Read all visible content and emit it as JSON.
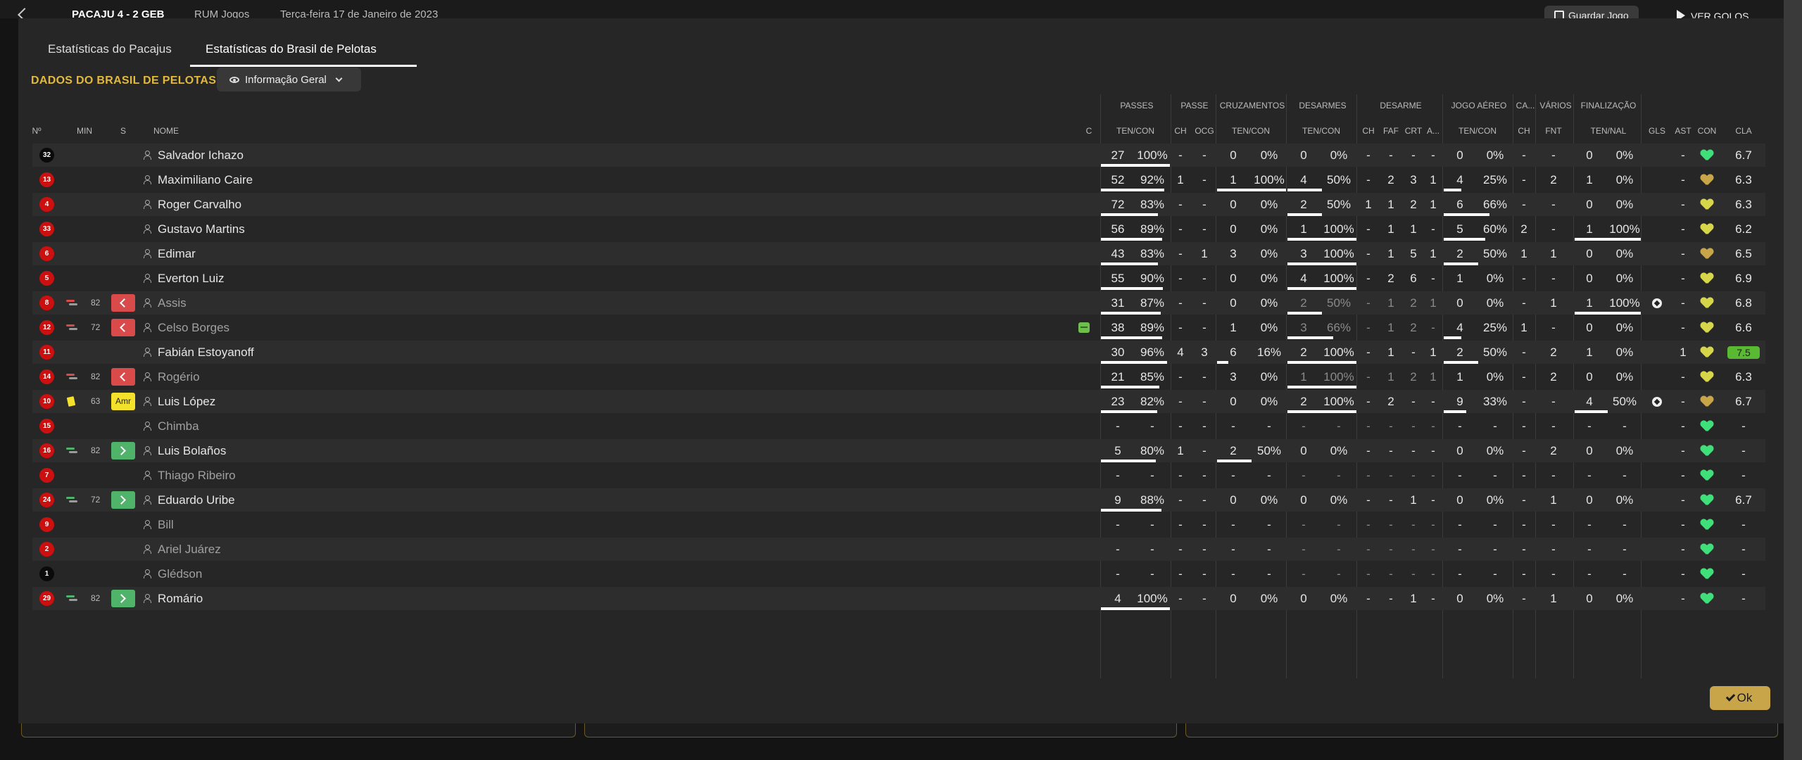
{
  "topbar": {
    "score_text": "PACAJU 4 - 2 GEB",
    "venue": "RUM Jogos",
    "date": "Terça-feira 17 de Janeiro de 2023",
    "save_label": "Guardar Jogo",
    "goals_label": "VER GOLOS"
  },
  "tabs": [
    {
      "label": "Estatísticas do Pacajus"
    },
    {
      "label": "Estatísticas do Brasil de Pelotas"
    }
  ],
  "section_title": "DADOS DO BRASIL DE PELOTAS",
  "view_dropdown": {
    "label": "Informação Geral"
  },
  "group_headers": {
    "passes": "PASSES",
    "passe": "PASSE",
    "cruzamentos": "CRUZAMENTOS",
    "desarmes": "DESARMES",
    "desarme": "DESARME",
    "jogo_aereo": "JOGO AÉREO",
    "ca": "CA...",
    "varios": "VÁRIOS",
    "finalizacao": "FINALIZAÇÃO"
  },
  "col_headers": {
    "num": "Nº",
    "min": "MIN",
    "s": "S",
    "nome": "NOME",
    "c": "C",
    "passes_tc": "TEN/CON",
    "passe_ch": "CH",
    "passe_ocg": "OCG",
    "cruz_tc": "TEN/CON",
    "des_tc": "TEN/CON",
    "d_ch": "CH",
    "d_faf": "FAF",
    "d_crt": "CRT",
    "d_a": "A...",
    "aer_tc": "TEN/CON",
    "ca_ch": "CH",
    "fnt": "FNT",
    "fin_tn": "TEN/NAL",
    "gls": "GLS",
    "ast": "AST",
    "con": "CON",
    "cla": "CLA"
  },
  "colors": {
    "accent": "#e2b93b",
    "ok_button": "#c9a54a",
    "kit_red": "#cc1010",
    "kit_black": "#0a0a0a"
  },
  "players": [
    {
      "num": "32",
      "kit": "black",
      "min": "",
      "sub": "",
      "name": "Salvador Ichazo",
      "active": true,
      "c": "",
      "pt": "27",
      "pp": "100%",
      "pb": 100,
      "pch": "-",
      "pocg": "-",
      "ct": "0",
      "cp": "0%",
      "cb": 0,
      "dt": "0",
      "dp": "0%",
      "db": 0,
      "dch": "-",
      "faf": "-",
      "crt": "-",
      "da": "-",
      "at": "0",
      "ap": "0%",
      "ab": 0,
      "cach": "-",
      "fnt": "-",
      "ft": "0",
      "fp": "0%",
      "fb": 0,
      "gls": "",
      "ast": "-",
      "con": "green",
      "cla": "6.7",
      "ball": false
    },
    {
      "num": "13",
      "kit": "red",
      "min": "",
      "sub": "",
      "name": "Maximiliano Caire",
      "active": true,
      "c": "",
      "pt": "52",
      "pp": "92%",
      "pb": 92,
      "pch": "1",
      "pocg": "-",
      "ct": "1",
      "cp": "100%",
      "cb": 100,
      "dt": "4",
      "dp": "50%",
      "db": 50,
      "dch": "-",
      "faf": "2",
      "crt": "3",
      "da": "1",
      "at": "4",
      "ap": "25%",
      "ab": 25,
      "cach": "-",
      "fnt": "2",
      "ft": "1",
      "fp": "0%",
      "fb": 0,
      "gls": "",
      "ast": "-",
      "con": "gold",
      "cla": "6.3",
      "ball": false
    },
    {
      "num": "4",
      "kit": "red",
      "min": "",
      "sub": "",
      "name": "Roger Carvalho",
      "active": true,
      "c": "",
      "pt": "72",
      "pp": "83%",
      "pb": 83,
      "pch": "-",
      "pocg": "-",
      "ct": "0",
      "cp": "0%",
      "cb": 0,
      "dt": "2",
      "dp": "50%",
      "db": 50,
      "dch": "1",
      "faf": "1",
      "crt": "2",
      "da": "1",
      "at": "6",
      "ap": "66%",
      "ab": 66,
      "cach": "-",
      "fnt": "-",
      "ft": "0",
      "fp": "0%",
      "fb": 0,
      "gls": "",
      "ast": "-",
      "con": "yellow",
      "cla": "6.3",
      "ball": false
    },
    {
      "num": "33",
      "kit": "red",
      "min": "",
      "sub": "",
      "name": "Gustavo Martins",
      "active": true,
      "c": "",
      "pt": "56",
      "pp": "89%",
      "pb": 89,
      "pch": "-",
      "pocg": "-",
      "ct": "0",
      "cp": "0%",
      "cb": 0,
      "dt": "1",
      "dp": "100%",
      "db": 100,
      "dch": "-",
      "faf": "1",
      "crt": "1",
      "da": "-",
      "at": "5",
      "ap": "60%",
      "ab": 60,
      "cach": "2",
      "fnt": "-",
      "ft": "1",
      "fp": "100%",
      "fb": 100,
      "gls": "",
      "ast": "-",
      "con": "yellow",
      "cla": "6.2",
      "ball": false
    },
    {
      "num": "6",
      "kit": "red",
      "min": "",
      "sub": "",
      "name": "Edimar",
      "active": true,
      "c": "",
      "pt": "43",
      "pp": "83%",
      "pb": 83,
      "pch": "-",
      "pocg": "1",
      "ct": "3",
      "cp": "0%",
      "cb": 0,
      "dt": "3",
      "dp": "100%",
      "db": 100,
      "dch": "-",
      "faf": "1",
      "crt": "5",
      "da": "1",
      "at": "2",
      "ap": "50%",
      "ab": 50,
      "cach": "1",
      "fnt": "1",
      "ft": "0",
      "fp": "0%",
      "fb": 0,
      "gls": "",
      "ast": "-",
      "con": "gold",
      "cla": "6.5",
      "ball": false
    },
    {
      "num": "5",
      "kit": "red",
      "min": "",
      "sub": "",
      "name": "Everton Luiz",
      "active": true,
      "c": "",
      "pt": "55",
      "pp": "90%",
      "pb": 90,
      "pch": "-",
      "pocg": "-",
      "ct": "0",
      "cp": "0%",
      "cb": 0,
      "dt": "4",
      "dp": "100%",
      "db": 100,
      "dch": "-",
      "faf": "2",
      "crt": "6",
      "da": "-",
      "at": "1",
      "ap": "0%",
      "ab": 0,
      "cach": "-",
      "fnt": "-",
      "ft": "0",
      "fp": "0%",
      "fb": 0,
      "gls": "",
      "ast": "-",
      "con": "yellow",
      "cla": "6.9",
      "ball": false
    },
    {
      "num": "8",
      "kit": "red",
      "min": "82",
      "sub": "out",
      "name": "Assis",
      "active": false,
      "c": "",
      "pt": "31",
      "pp": "87%",
      "pb": 87,
      "pch": "-",
      "pocg": "-",
      "ct": "0",
      "cp": "0%",
      "cb": 0,
      "dt": "2",
      "dp": "50%",
      "db": 50,
      "dch": "-",
      "faf": "1",
      "crt": "2",
      "da": "1",
      "at": "0",
      "ap": "0%",
      "ab": 0,
      "cach": "-",
      "fnt": "1",
      "ft": "1",
      "fp": "100%",
      "fb": 100,
      "gls": "ball",
      "ast": "-",
      "con": "yellow",
      "cla": "6.8",
      "ball": true
    },
    {
      "num": "12",
      "kit": "red",
      "min": "72",
      "sub": "out",
      "name": "Celso Borges",
      "active": false,
      "c": "injury",
      "pt": "38",
      "pp": "89%",
      "pb": 89,
      "pch": "-",
      "pocg": "-",
      "ct": "1",
      "cp": "0%",
      "cb": 0,
      "dt": "3",
      "dp": "66%",
      "db": 66,
      "dch": "-",
      "faf": "1",
      "crt": "2",
      "da": "-",
      "at": "4",
      "ap": "25%",
      "ab": 25,
      "cach": "1",
      "fnt": "-",
      "ft": "0",
      "fp": "0%",
      "fb": 0,
      "gls": "",
      "ast": "-",
      "con": "yellow",
      "cla": "6.6",
      "ball": false
    },
    {
      "num": "11",
      "kit": "red",
      "min": "",
      "sub": "",
      "name": "Fabián Estoyanoff",
      "active": true,
      "c": "",
      "pt": "30",
      "pp": "96%",
      "pb": 96,
      "pch": "4",
      "pocg": "3",
      "ct": "6",
      "cp": "16%",
      "cb": 16,
      "dt": "2",
      "dp": "100%",
      "db": 100,
      "dch": "-",
      "faf": "1",
      "crt": "-",
      "da": "1",
      "at": "2",
      "ap": "50%",
      "ab": 50,
      "cach": "-",
      "fnt": "2",
      "ft": "1",
      "fp": "0%",
      "fb": 0,
      "gls": "",
      "ast": "1",
      "con": "yellow",
      "cla": "7.5",
      "ball": false
    },
    {
      "num": "14",
      "kit": "red",
      "min": "82",
      "sub": "out",
      "name": "Rogério",
      "active": false,
      "c": "",
      "pt": "21",
      "pp": "85%",
      "pb": 85,
      "pch": "-",
      "pocg": "-",
      "ct": "3",
      "cp": "0%",
      "cb": 0,
      "dt": "1",
      "dp": "100%",
      "db": 100,
      "dch": "-",
      "faf": "1",
      "crt": "2",
      "da": "1",
      "at": "1",
      "ap": "0%",
      "ab": 0,
      "cach": "-",
      "fnt": "2",
      "ft": "0",
      "fp": "0%",
      "fb": 0,
      "gls": "",
      "ast": "-",
      "con": "yellow",
      "cla": "6.3",
      "ball": false
    },
    {
      "num": "10",
      "kit": "red",
      "min": "63",
      "sub": "card",
      "name": "Luis López",
      "active": true,
      "c": "",
      "pt": "23",
      "pp": "82%",
      "pb": 82,
      "pch": "-",
      "pocg": "-",
      "ct": "0",
      "cp": "0%",
      "cb": 0,
      "dt": "2",
      "dp": "100%",
      "db": 100,
      "dch": "-",
      "faf": "2",
      "crt": "-",
      "da": "-",
      "at": "9",
      "ap": "33%",
      "ab": 33,
      "cach": "-",
      "fnt": "-",
      "ft": "4",
      "fp": "50%",
      "fb": 50,
      "gls": "ball",
      "ast": "-",
      "con": "gold",
      "cla": "6.7",
      "ball": true
    },
    {
      "num": "15",
      "kit": "red",
      "min": "",
      "sub": "",
      "name": "Chimba",
      "active": false,
      "c": "",
      "pt": "-",
      "pp": "-",
      "pb": 0,
      "pch": "-",
      "pocg": "-",
      "ct": "-",
      "cp": "-",
      "cb": 0,
      "dt": "-",
      "dp": "-",
      "db": 0,
      "dch": "-",
      "faf": "-",
      "crt": "-",
      "da": "-",
      "at": "-",
      "ap": "-",
      "ab": 0,
      "cach": "-",
      "fnt": "-",
      "ft": "-",
      "fp": "-",
      "fb": 0,
      "gls": "",
      "ast": "-",
      "con": "green",
      "cla": "-",
      "ball": false
    },
    {
      "num": "16",
      "kit": "red",
      "min": "82",
      "sub": "in",
      "name": "Luis Bolaños",
      "active": true,
      "c": "",
      "pt": "5",
      "pp": "80%",
      "pb": 80,
      "pch": "1",
      "pocg": "-",
      "ct": "2",
      "cp": "50%",
      "cb": 50,
      "dt": "0",
      "dp": "0%",
      "db": 0,
      "dch": "-",
      "faf": "-",
      "crt": "-",
      "da": "-",
      "at": "0",
      "ap": "0%",
      "ab": 0,
      "cach": "-",
      "fnt": "2",
      "ft": "0",
      "fp": "0%",
      "fb": 0,
      "gls": "",
      "ast": "-",
      "con": "green",
      "cla": "-",
      "ball": false
    },
    {
      "num": "7",
      "kit": "red",
      "min": "",
      "sub": "",
      "name": "Thiago Ribeiro",
      "active": false,
      "c": "",
      "pt": "-",
      "pp": "-",
      "pb": 0,
      "pch": "-",
      "pocg": "-",
      "ct": "-",
      "cp": "-",
      "cb": 0,
      "dt": "-",
      "dp": "-",
      "db": 0,
      "dch": "-",
      "faf": "-",
      "crt": "-",
      "da": "-",
      "at": "-",
      "ap": "-",
      "ab": 0,
      "cach": "-",
      "fnt": "-",
      "ft": "-",
      "fp": "-",
      "fb": 0,
      "gls": "",
      "ast": "-",
      "con": "green",
      "cla": "-",
      "ball": false
    },
    {
      "num": "24",
      "kit": "red",
      "min": "72",
      "sub": "in",
      "name": "Eduardo Uribe",
      "active": true,
      "c": "",
      "pt": "9",
      "pp": "88%",
      "pb": 88,
      "pch": "-",
      "pocg": "-",
      "ct": "0",
      "cp": "0%",
      "cb": 0,
      "dt": "0",
      "dp": "0%",
      "db": 0,
      "dch": "-",
      "faf": "-",
      "crt": "1",
      "da": "-",
      "at": "0",
      "ap": "0%",
      "ab": 0,
      "cach": "-",
      "fnt": "1",
      "ft": "0",
      "fp": "0%",
      "fb": 0,
      "gls": "",
      "ast": "-",
      "con": "green",
      "cla": "6.7",
      "ball": false
    },
    {
      "num": "9",
      "kit": "red",
      "min": "",
      "sub": "",
      "name": "Bill",
      "active": false,
      "c": "",
      "pt": "-",
      "pp": "-",
      "pb": 0,
      "pch": "-",
      "pocg": "-",
      "ct": "-",
      "cp": "-",
      "cb": 0,
      "dt": "-",
      "dp": "-",
      "db": 0,
      "dch": "-",
      "faf": "-",
      "crt": "-",
      "da": "-",
      "at": "-",
      "ap": "-",
      "ab": 0,
      "cach": "-",
      "fnt": "-",
      "ft": "-",
      "fp": "-",
      "fb": 0,
      "gls": "",
      "ast": "-",
      "con": "green",
      "cla": "-",
      "ball": false
    },
    {
      "num": "2",
      "kit": "red",
      "min": "",
      "sub": "",
      "name": "Ariel Juárez",
      "active": false,
      "c": "",
      "pt": "-",
      "pp": "-",
      "pb": 0,
      "pch": "-",
      "pocg": "-",
      "ct": "-",
      "cp": "-",
      "cb": 0,
      "dt": "-",
      "dp": "-",
      "db": 0,
      "dch": "-",
      "faf": "-",
      "crt": "-",
      "da": "-",
      "at": "-",
      "ap": "-",
      "ab": 0,
      "cach": "-",
      "fnt": "-",
      "ft": "-",
      "fp": "-",
      "fb": 0,
      "gls": "",
      "ast": "-",
      "con": "green",
      "cla": "-",
      "ball": false
    },
    {
      "num": "1",
      "kit": "black",
      "min": "",
      "sub": "",
      "name": "Glédson",
      "active": false,
      "c": "",
      "pt": "-",
      "pp": "-",
      "pb": 0,
      "pch": "-",
      "pocg": "-",
      "ct": "-",
      "cp": "-",
      "cb": 0,
      "dt": "-",
      "dp": "-",
      "db": 0,
      "dch": "-",
      "faf": "-",
      "crt": "-",
      "da": "-",
      "at": "-",
      "ap": "-",
      "ab": 0,
      "cach": "-",
      "fnt": "-",
      "ft": "-",
      "fp": "-",
      "fb": 0,
      "gls": "",
      "ast": "-",
      "con": "green",
      "cla": "-",
      "ball": false
    },
    {
      "num": "29",
      "kit": "red",
      "min": "82",
      "sub": "in",
      "name": "Romário",
      "active": true,
      "c": "",
      "pt": "4",
      "pp": "100%",
      "pb": 100,
      "pch": "-",
      "pocg": "-",
      "ct": "0",
      "cp": "0%",
      "cb": 0,
      "dt": "0",
      "dp": "0%",
      "db": 0,
      "dch": "-",
      "faf": "-",
      "crt": "1",
      "da": "-",
      "at": "0",
      "ap": "0%",
      "ab": 0,
      "cach": "-",
      "fnt": "1",
      "ft": "0",
      "fp": "0%",
      "fb": 0,
      "gls": "",
      "ast": "-",
      "con": "green",
      "cla": "-",
      "ball": false
    }
  ],
  "sub_card_label": "Amr",
  "ok_label": "Ok"
}
